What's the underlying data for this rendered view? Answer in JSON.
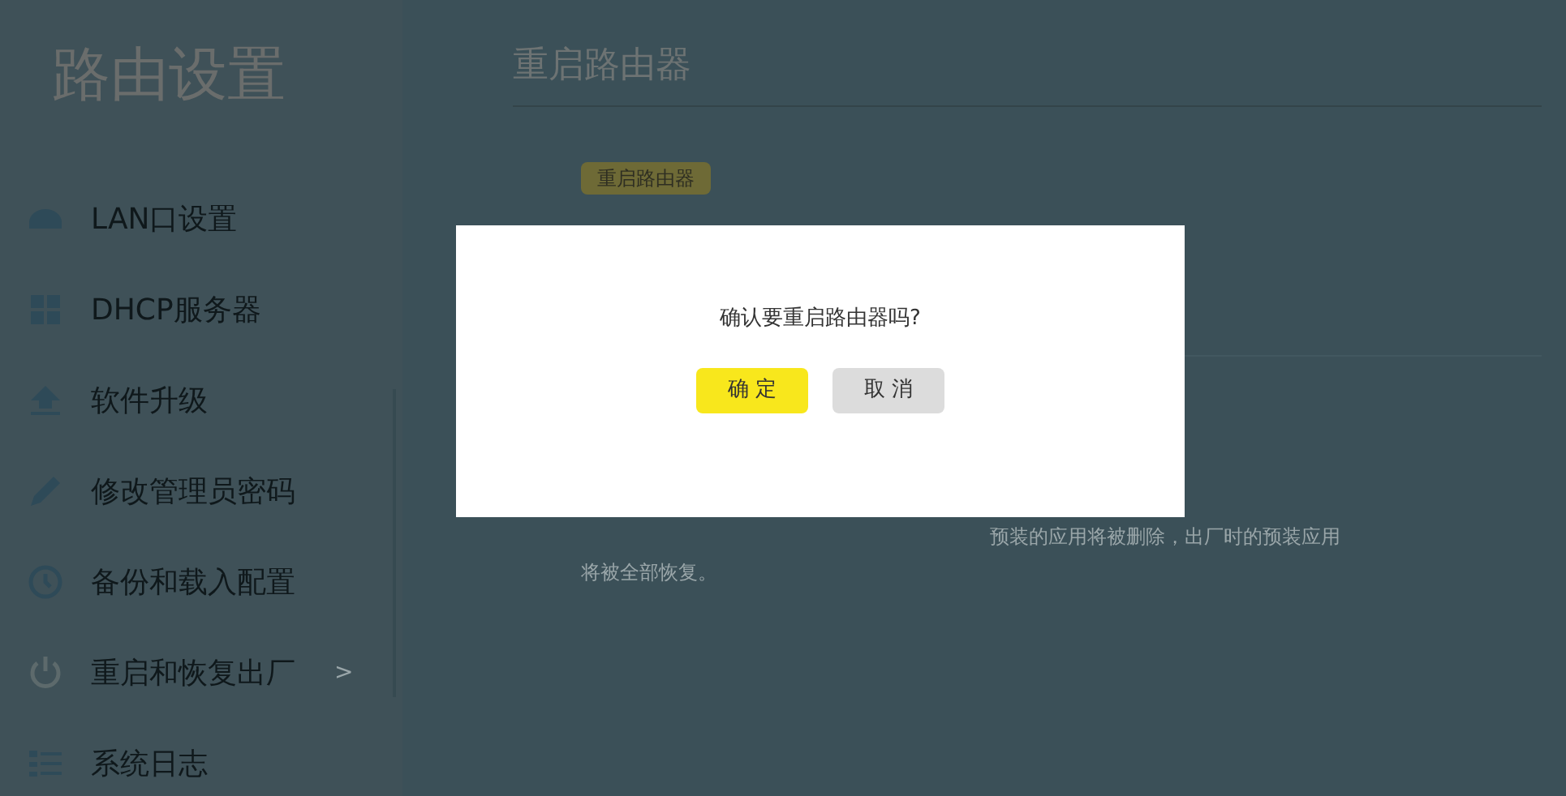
{
  "sidebar": {
    "title": "路由设置",
    "items": [
      {
        "label": "LAN口设置",
        "kind": "lan"
      },
      {
        "label": "DHCP服务器",
        "kind": "dhcp"
      },
      {
        "label": "软件升级",
        "kind": "upload"
      },
      {
        "label": "修改管理员密码",
        "kind": "pencil"
      },
      {
        "label": "备份和载入配置",
        "kind": "history"
      },
      {
        "label": "重启和恢复出厂",
        "kind": "power",
        "suffix": ">"
      },
      {
        "label": "系统日志",
        "kind": "list"
      }
    ]
  },
  "main": {
    "heading": "重启路由器",
    "reboot_button": "重启路由器",
    "note_line_1": "预装的应用将被删除，出厂时的预装应用",
    "note_line_2": "将被全部恢复。"
  },
  "dialog": {
    "message": "确认要重启路由器吗?",
    "confirm": "确 定",
    "cancel": "取 消"
  }
}
